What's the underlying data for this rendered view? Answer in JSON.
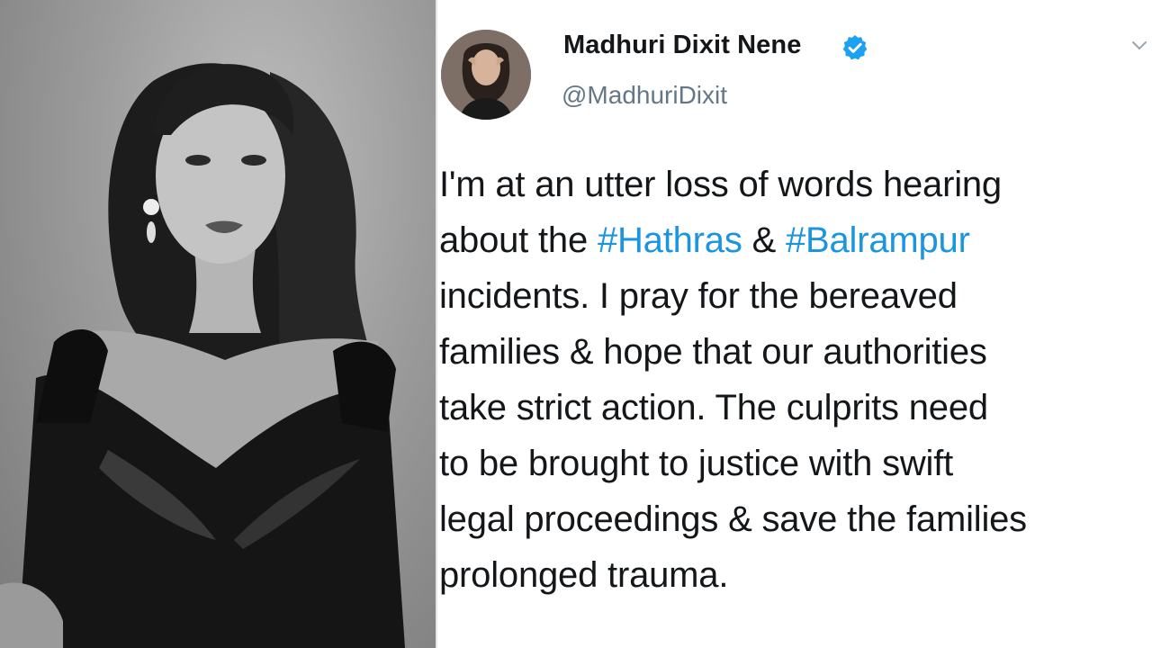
{
  "tweet": {
    "display_name": "Madhuri Dixit Nene",
    "handle": "@MadhuriDixit",
    "verified_badge_icon": "verified-check-icon",
    "menu_icon": "chevron-down-icon",
    "text": {
      "line1": "I'm at an utter loss of words hearing",
      "line2_prefix": "about the ",
      "hashtag1": "#Hathras",
      "line2_middle": " & ",
      "hashtag2": "#Balrampur",
      "line3": "incidents. I pray for the bereaved",
      "line4": "families & hope that our authorities",
      "line5": "take strict action. The culprits need",
      "line6": "to be brought to justice with swift",
      "line7": "legal proceedings & save the families",
      "line8": "prolonged trauma."
    }
  },
  "colors": {
    "hashtag": "#1b95e0",
    "verified": "#1da1f2",
    "handle": "#657786",
    "text": "#14171a"
  }
}
